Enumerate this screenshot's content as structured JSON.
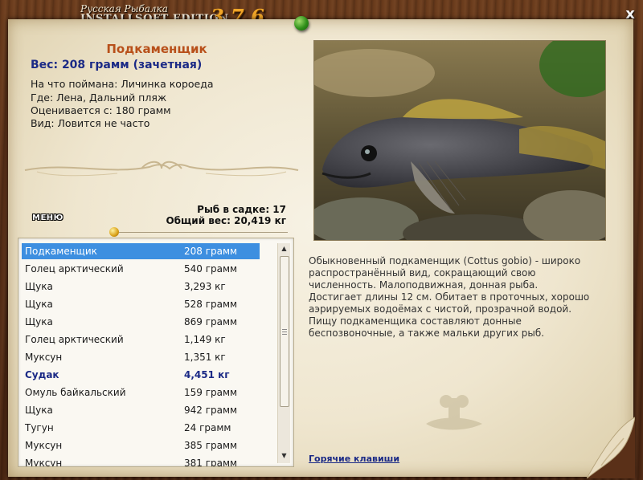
{
  "window": {
    "title_top": "Русская Рыбалка",
    "title_main": "INSTALLSOFT EDITION",
    "version": "3.7.6",
    "close_label": "x"
  },
  "fish": {
    "name": "Подкаменщик",
    "weight_line": "Вес: 208 грамм (зачетная)",
    "bait_line": "На что поймана: Личинка короеда",
    "place_line": "Где: Лена, Дальний пляж",
    "rating_line": "Оценивается с: 180 грамм",
    "kind_line": "Вид: Ловится не часто"
  },
  "cage": {
    "count_line": "Рыб в садке: 17",
    "total_line": "Общий вес: 20,419 кг"
  },
  "menu_label": "МЕНЮ",
  "catch_list": [
    {
      "name": "Подкаменщик",
      "weight": "208 грамм",
      "selected": true,
      "bold": false
    },
    {
      "name": "Голец арктический",
      "weight": "540 грамм",
      "selected": false,
      "bold": false
    },
    {
      "name": "Щука",
      "weight": "3,293 кг",
      "selected": false,
      "bold": false
    },
    {
      "name": "Щука",
      "weight": "528 грамм",
      "selected": false,
      "bold": false
    },
    {
      "name": "Щука",
      "weight": "869 грамм",
      "selected": false,
      "bold": false
    },
    {
      "name": "Голец арктический",
      "weight": "1,149 кг",
      "selected": false,
      "bold": false
    },
    {
      "name": "Муксун",
      "weight": "1,351 кг",
      "selected": false,
      "bold": false
    },
    {
      "name": "Судак",
      "weight": "4,451 кг",
      "selected": false,
      "bold": true
    },
    {
      "name": "Омуль байкальский",
      "weight": "159 грамм",
      "selected": false,
      "bold": false
    },
    {
      "name": "Щука",
      "weight": "942 грамм",
      "selected": false,
      "bold": false
    },
    {
      "name": "Тугун",
      "weight": "24 грамм",
      "selected": false,
      "bold": false
    },
    {
      "name": "Муксун",
      "weight": "385 грамм",
      "selected": false,
      "bold": false
    },
    {
      "name": "Муксун",
      "weight": "381 грамм",
      "selected": false,
      "bold": false
    }
  ],
  "description": [
    "Обыкновенный подкаменщик (Cottus gobio) - широко",
    "распространённый вид, сокращающий свою",
    "численность. Малоподвижная, донная рыба.",
    "Достигает длины 12 см. Обитает в проточных, хорошо",
    "аэрируемых водоёмах с чистой, прозрачной водой.",
    "Пищу подкаменщика составляют донные",
    "беспозвоночные, а также мальки других рыб."
  ],
  "hotkeys_label": "Горячие клавиши",
  "colors": {
    "fish_name": "#b8501a",
    "weight_text": "#1b2a86",
    "selection": "#3d8fe0",
    "version": "#f0a628"
  }
}
